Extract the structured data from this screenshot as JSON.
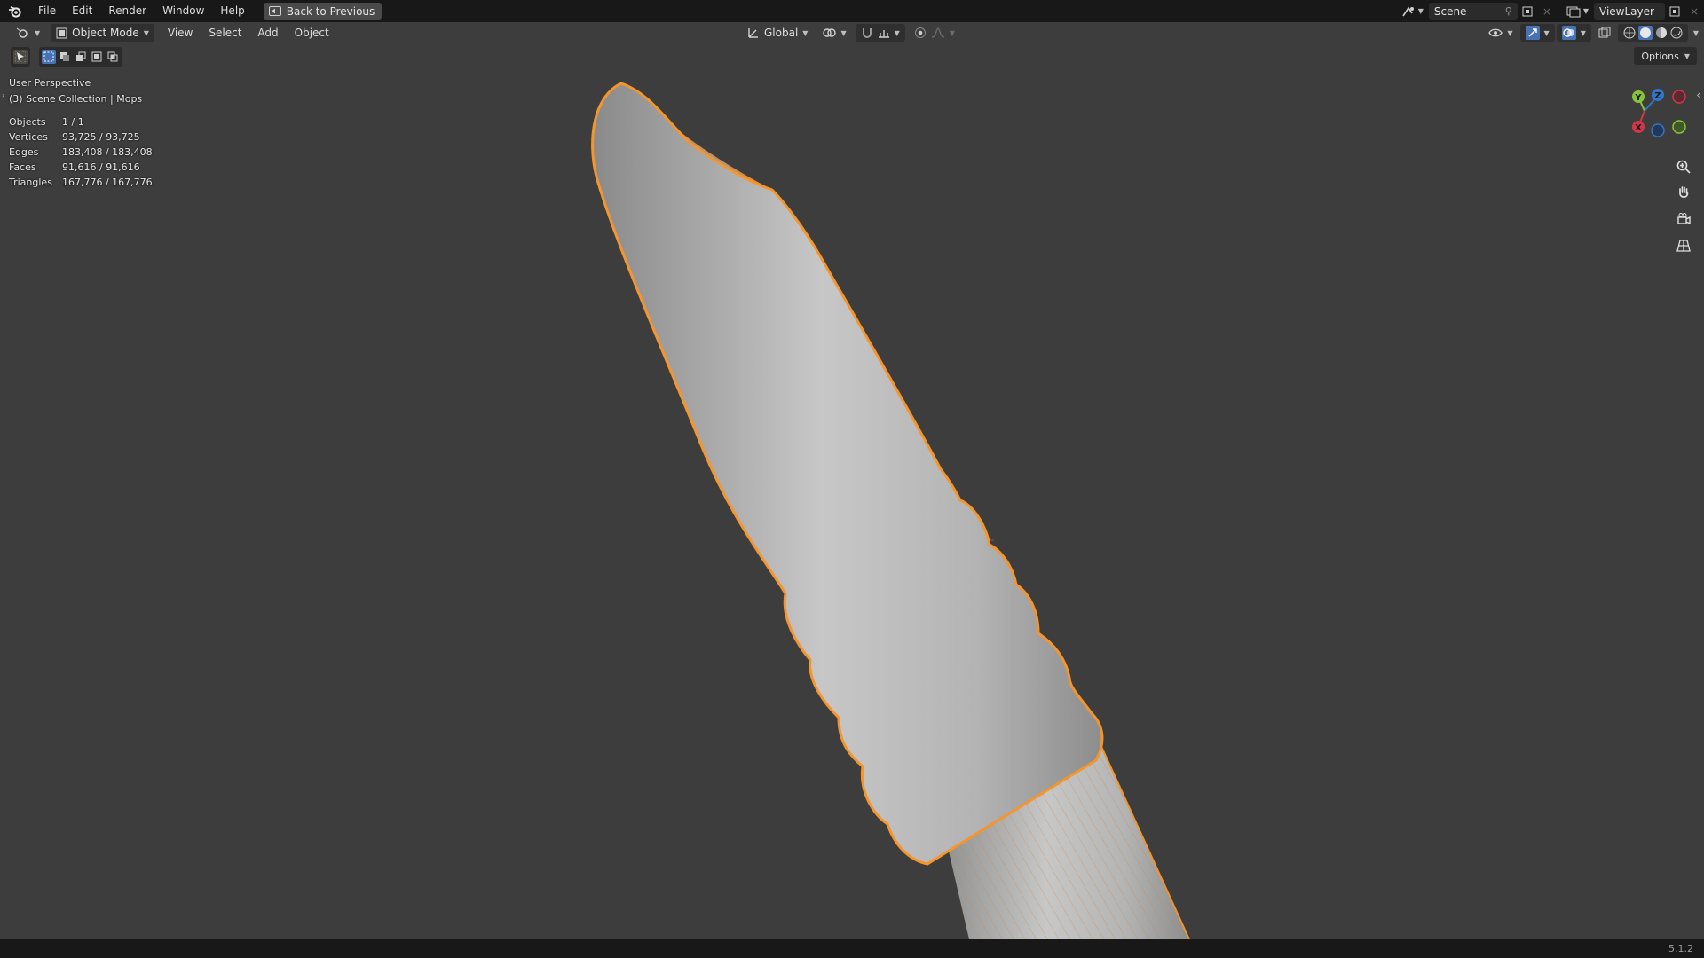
{
  "menu": {
    "file": "File",
    "edit": "Edit",
    "render": "Render",
    "window": "Window",
    "help": "Help",
    "back_to_previous": "Back to Previous"
  },
  "topright": {
    "scene": "Scene",
    "view_layer": "ViewLayer"
  },
  "viewport_header": {
    "mode": "Object Mode",
    "view": "View",
    "select": "Select",
    "add": "Add",
    "object": "Object",
    "transform_orientation": "Global",
    "options": "Options"
  },
  "overlay": {
    "view_name": "User Perspective",
    "collection": "(3) Scene Collection | Mops",
    "stats": [
      {
        "label": "Objects",
        "value": "1 / 1"
      },
      {
        "label": "Vertices",
        "value": "93,725 / 93,725"
      },
      {
        "label": "Edges",
        "value": "183,408 / 183,408"
      },
      {
        "label": "Faces",
        "value": "91,616 / 91,616"
      },
      {
        "label": "Triangles",
        "value": "167,776 / 167,776"
      }
    ]
  },
  "gizmo": {
    "y": "Y",
    "z": "Z",
    "x": "X"
  },
  "colors": {
    "selection_outline": "#f5952c",
    "axis_x": "#d2364a",
    "axis_y": "#88c438",
    "axis_z": "#3375c9"
  },
  "statusbar": {
    "version": "5.1.2"
  }
}
